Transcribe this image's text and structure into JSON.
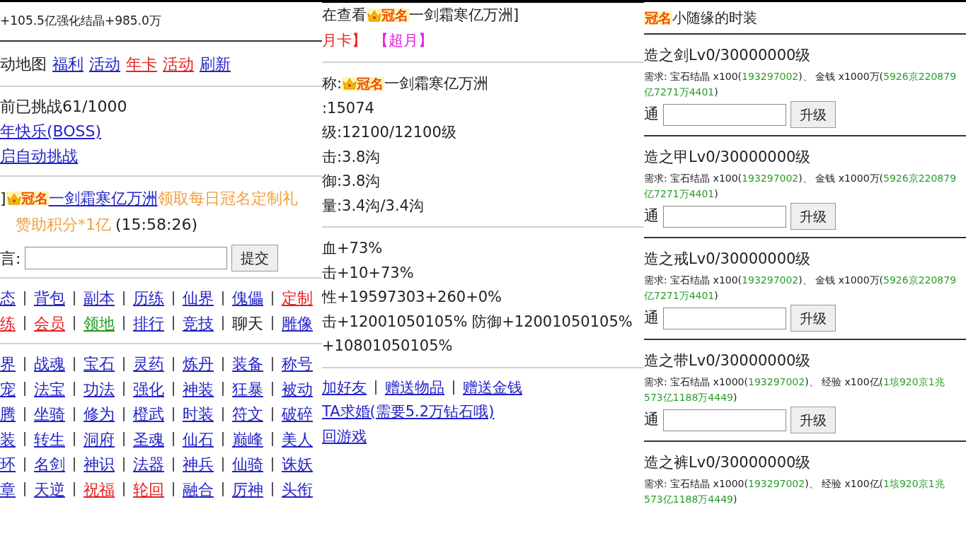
{
  "left": {
    "summary": "+105.5亿强化结晶+985.0万",
    "nav": {
      "label": "动地图",
      "links": [
        {
          "text": "福利",
          "color": "#2323c8"
        },
        {
          "text": "活动",
          "color": "#2323c8"
        },
        {
          "text": "年卡",
          "color": "#e52222"
        },
        {
          "text": "活动",
          "color": "#e52222"
        },
        {
          "text": "刷新",
          "color": "#2323c8"
        }
      ]
    },
    "challenge": {
      "status": "前已挑战61/1000",
      "links": [
        "年快乐(BOSS)",
        "启自动挑战"
      ]
    },
    "notice": {
      "prefix": "]",
      "badge": {
        "text": "冠名",
        "crown": true
      },
      "name": "一剑霜寒亿万洲",
      "message": "领取每日冠名定制礼",
      "reward": "赞助积分*1亿",
      "time": "(15:58:26)"
    },
    "message_form": {
      "label": "言:",
      "button": "提交"
    },
    "menu_groups": [
      [
        [
          {
            "text": "态",
            "color": "#2323c8",
            "kind": "link"
          },
          {
            "text": "背包",
            "color": "#2323c8",
            "kind": "link"
          },
          {
            "text": "副本",
            "color": "#2323c8",
            "kind": "link"
          },
          {
            "text": "历练",
            "color": "#2323c8",
            "kind": "link"
          },
          {
            "text": "仙界",
            "color": "#2323c8",
            "kind": "link"
          },
          {
            "text": "傀儡",
            "color": "#2323c8",
            "kind": "link"
          },
          {
            "text": "定制",
            "color": "#e52222",
            "kind": "link"
          }
        ],
        [
          {
            "text": "练",
            "color": "#e52222",
            "kind": "link"
          },
          {
            "text": "会员",
            "color": "#e52222",
            "kind": "link"
          },
          {
            "text": "领地",
            "color": "#229922",
            "kind": "link"
          },
          {
            "text": "排行",
            "color": "#2323c8",
            "kind": "link"
          },
          {
            "text": "竞技",
            "color": "#2323c8",
            "kind": "link"
          },
          {
            "text": "聊天",
            "color": "#222222",
            "kind": "text"
          },
          {
            "text": "雕像",
            "color": "#2323c8",
            "kind": "link"
          }
        ]
      ],
      [
        [
          {
            "text": "界",
            "color": "#2323c8",
            "kind": "link"
          },
          {
            "text": "战魂",
            "color": "#2323c8",
            "kind": "link"
          },
          {
            "text": "宝石",
            "color": "#2323c8",
            "kind": "link"
          },
          {
            "text": "灵药",
            "color": "#2323c8",
            "kind": "link"
          },
          {
            "text": "炼丹",
            "color": "#2323c8",
            "kind": "link"
          },
          {
            "text": "装备",
            "color": "#2323c8",
            "kind": "link"
          },
          {
            "text": "称号",
            "color": "#2323c8",
            "kind": "link"
          }
        ],
        [
          {
            "text": "宠",
            "color": "#2323c8",
            "kind": "link"
          },
          {
            "text": "法宝",
            "color": "#2323c8",
            "kind": "link"
          },
          {
            "text": "功法",
            "color": "#2323c8",
            "kind": "link"
          },
          {
            "text": "强化",
            "color": "#2323c8",
            "kind": "link"
          },
          {
            "text": "神装",
            "color": "#2323c8",
            "kind": "link"
          },
          {
            "text": "狂暴",
            "color": "#2323c8",
            "kind": "link"
          },
          {
            "text": "被动",
            "color": "#2323c8",
            "kind": "link"
          }
        ],
        [
          {
            "text": "腾",
            "color": "#2323c8",
            "kind": "link"
          },
          {
            "text": "坐骑",
            "color": "#2323c8",
            "kind": "link"
          },
          {
            "text": "修为",
            "color": "#2323c8",
            "kind": "link"
          },
          {
            "text": "橙武",
            "color": "#2323c8",
            "kind": "link"
          },
          {
            "text": "时装",
            "color": "#2323c8",
            "kind": "link"
          },
          {
            "text": "符文",
            "color": "#2323c8",
            "kind": "link"
          },
          {
            "text": "破碎",
            "color": "#2323c8",
            "kind": "link"
          }
        ],
        [
          {
            "text": "装",
            "color": "#2323c8",
            "kind": "link"
          },
          {
            "text": "转生",
            "color": "#2323c8",
            "kind": "link"
          },
          {
            "text": "洞府",
            "color": "#2323c8",
            "kind": "link"
          },
          {
            "text": "圣魂",
            "color": "#2323c8",
            "kind": "link"
          },
          {
            "text": "仙石",
            "color": "#2323c8",
            "kind": "link"
          },
          {
            "text": "巅峰",
            "color": "#2323c8",
            "kind": "link"
          },
          {
            "text": "美人",
            "color": "#2323c8",
            "kind": "link"
          }
        ],
        [
          {
            "text": "环",
            "color": "#2323c8",
            "kind": "link"
          },
          {
            "text": "名剑",
            "color": "#2323c8",
            "kind": "link"
          },
          {
            "text": "神识",
            "color": "#2323c8",
            "kind": "link"
          },
          {
            "text": "法器",
            "color": "#2323c8",
            "kind": "link"
          },
          {
            "text": "神兵",
            "color": "#2323c8",
            "kind": "link"
          },
          {
            "text": "仙骑",
            "color": "#2323c8",
            "kind": "link"
          },
          {
            "text": "诛妖",
            "color": "#2323c8",
            "kind": "link"
          }
        ],
        [
          {
            "text": "章",
            "color": "#2323c8",
            "kind": "link"
          },
          {
            "text": "天逆",
            "color": "#2323c8",
            "kind": "link"
          },
          {
            "text": "祝福",
            "color": "#e52222",
            "kind": "link"
          },
          {
            "text": "轮回",
            "color": "#e52222",
            "kind": "link"
          },
          {
            "text": "融合",
            "color": "#2323c8",
            "kind": "link"
          },
          {
            "text": "厉神",
            "color": "#2323c8",
            "kind": "link"
          },
          {
            "text": "头衔",
            "color": "#2323c8",
            "kind": "link"
          }
        ]
      ]
    ]
  },
  "middle": {
    "viewing": {
      "prefix": "在查看",
      "badge": {
        "text": "冠名",
        "crown": true
      },
      "name": "一剑霜寒亿万洲]"
    },
    "cards": [
      {
        "text": "月卡】",
        "color": "#e52222"
      },
      {
        "text": "【超月】",
        "color": "#e020e0"
      }
    ],
    "profile": {
      "title_label": "称:",
      "badge": {
        "text": "冠名",
        "crown": true
      },
      "title_name": "一剑霜寒亿万洲",
      "stats": [
        ":15074",
        "级:12100/12100级",
        "击:3.8沟",
        "御:3.8沟",
        "量:3.4沟/3.4沟"
      ]
    },
    "bonuses": [
      "血+73%",
      "击+10+73%",
      "性+19597303+260+0%",
      "击+12001050105% 防御+12001050105%",
      "+10801050105%"
    ],
    "actions": [
      [
        "加好友",
        "赠送物品",
        "赠送金钱"
      ],
      [
        "TA求婚(需要5.2万钻石哦)"
      ],
      [
        "回游戏"
      ]
    ]
  },
  "right": {
    "title": {
      "badge": {
        "text": "冠名",
        "crown": false
      },
      "text": "小随缘的时装"
    },
    "items": [
      {
        "name": "造之剑Lv0/30000000级",
        "requirement": [
          {
            "kind": "plain",
            "text": "需求: 宝石结晶 x100("
          },
          {
            "kind": "owned",
            "text": "193297002"
          },
          {
            "kind": "plain",
            "text": ")、 金钱 x1000万("
          },
          {
            "kind": "owned",
            "text": "5926京220879亿7271万4401"
          },
          {
            "kind": "plain",
            "text": ")"
          }
        ],
        "upgrade": {
          "label": "通",
          "button": "升级"
        }
      },
      {
        "name": "造之甲Lv0/30000000级",
        "requirement": [
          {
            "kind": "plain",
            "text": "需求: 宝石结晶 x100("
          },
          {
            "kind": "owned",
            "text": "193297002"
          },
          {
            "kind": "plain",
            "text": ")、 金钱 x1000万("
          },
          {
            "kind": "owned",
            "text": "5926京220879亿7271万4401"
          },
          {
            "kind": "plain",
            "text": ")"
          }
        ],
        "upgrade": {
          "label": "通",
          "button": "升级"
        }
      },
      {
        "name": "造之戒Lv0/30000000级",
        "requirement": [
          {
            "kind": "plain",
            "text": "需求: 宝石结晶 x100("
          },
          {
            "kind": "owned",
            "text": "193297002"
          },
          {
            "kind": "plain",
            "text": ")、 金钱 x1000万("
          },
          {
            "kind": "owned",
            "text": "5926京220879亿7271万4401"
          },
          {
            "kind": "plain",
            "text": ")"
          }
        ],
        "upgrade": {
          "label": "通",
          "button": "升级"
        }
      },
      {
        "name": "造之带Lv0/30000000级",
        "requirement": [
          {
            "kind": "plain",
            "text": "需求: 宝石结晶 x1000("
          },
          {
            "kind": "owned",
            "text": "193297002"
          },
          {
            "kind": "plain",
            "text": ")、 经验 x100亿("
          },
          {
            "kind": "owned",
            "text": "1垓920京1兆573亿1188万4449"
          },
          {
            "kind": "plain",
            "text": ")"
          }
        ],
        "upgrade": {
          "label": "通",
          "button": "升级"
        }
      },
      {
        "name": "造之裤Lv0/30000000级",
        "requirement": [
          {
            "kind": "plain",
            "text": "需求: 宝石结晶 x1000("
          },
          {
            "kind": "owned",
            "text": "193297002"
          },
          {
            "kind": "plain",
            "text": ")、 经验 x100亿("
          },
          {
            "kind": "owned",
            "text": "1垓920京1兆573亿1188万4449"
          },
          {
            "kind": "plain",
            "text": ")"
          }
        ]
      }
    ]
  }
}
